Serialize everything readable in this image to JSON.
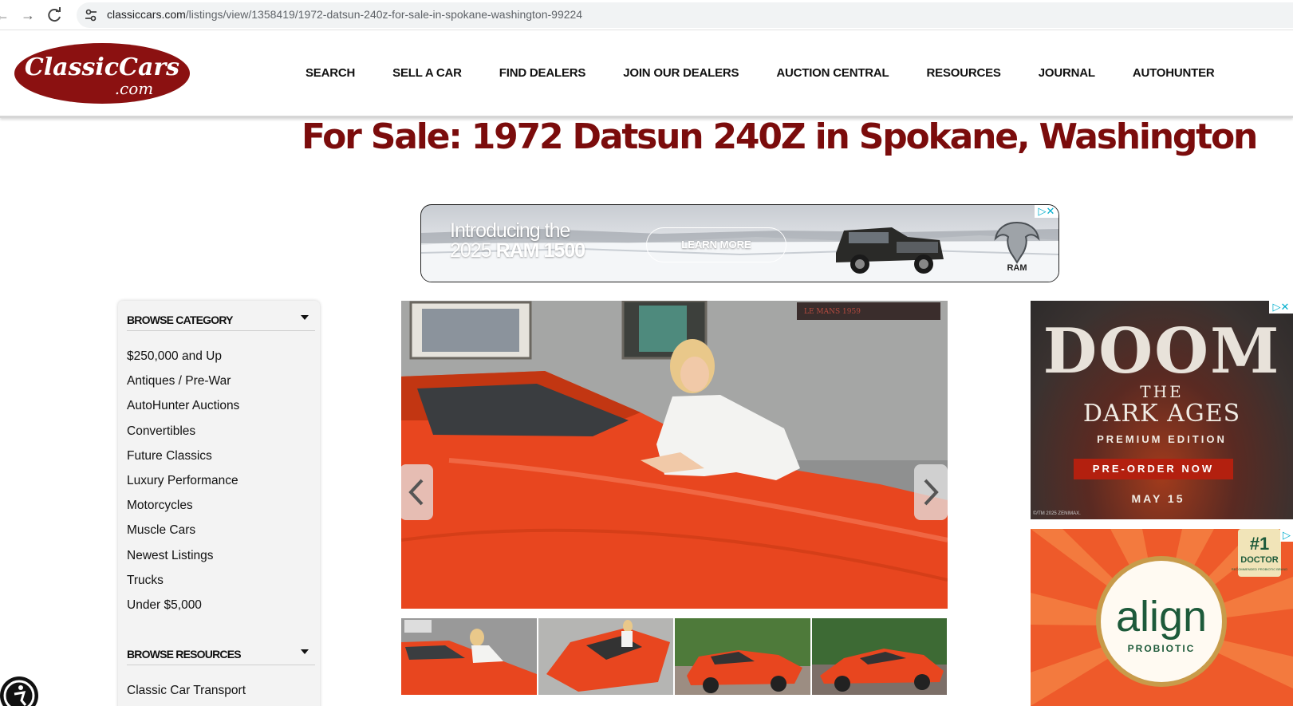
{
  "browser": {
    "url_domain": "classiccars.com",
    "url_path": "/listings/view/1358419/1972-datsun-240z-for-sale-in-spokane-washington-99224"
  },
  "header": {
    "logo_text": "ClassicCars.com",
    "nav": [
      "SEARCH",
      "SELL A CAR",
      "FIND DEALERS",
      "JOIN OUR DEALERS",
      "AUCTION CENTRAL",
      "RESOURCES",
      "JOURNAL",
      "AUTOHUNTER"
    ]
  },
  "page": {
    "title": "For Sale: 1972 Datsun 240Z in Spokane, Washington"
  },
  "ad_top": {
    "intro_line1": "Introducing the",
    "intro_year": "2025",
    "intro_model": "RAM 1500",
    "cta": "LEARN MORE",
    "brand": "RAM"
  },
  "sidebar": {
    "browse_category": {
      "heading": "BROWSE CATEGORY",
      "items": [
        "$250,000 and Up",
        "Antiques / Pre-War",
        "AutoHunter Auctions",
        "Convertibles",
        "Future Classics",
        "Luxury Performance",
        "Motorcycles",
        "Muscle Cars",
        "Newest Listings",
        "Trucks",
        "Under $5,000"
      ]
    },
    "browse_resources": {
      "heading": "BROWSE RESOURCES",
      "items": [
        "Classic Car Transport"
      ]
    }
  },
  "gallery": {
    "banner_text": "LE MANS 1959",
    "thumbnail_count": 4
  },
  "ad_doom": {
    "title": "DOOM",
    "the": "THE",
    "subtitle": "DARK AGES",
    "edition": "PREMIUM EDITION",
    "cta": "PRE-ORDER NOW",
    "date": "MAY 15",
    "legal": "©/TM 2025 ZENIMAX."
  },
  "ad_align": {
    "brand": "align",
    "sub": "PROBIOTIC",
    "badge_top": "#1",
    "badge_mid": "DOCTOR",
    "badge_small": "RECOMMENDED PROBIOTIC BRAND"
  },
  "colors": {
    "brand_red": "#7b0c0c",
    "logo_red": "#8b1111",
    "car_orange": "#e8461f"
  }
}
